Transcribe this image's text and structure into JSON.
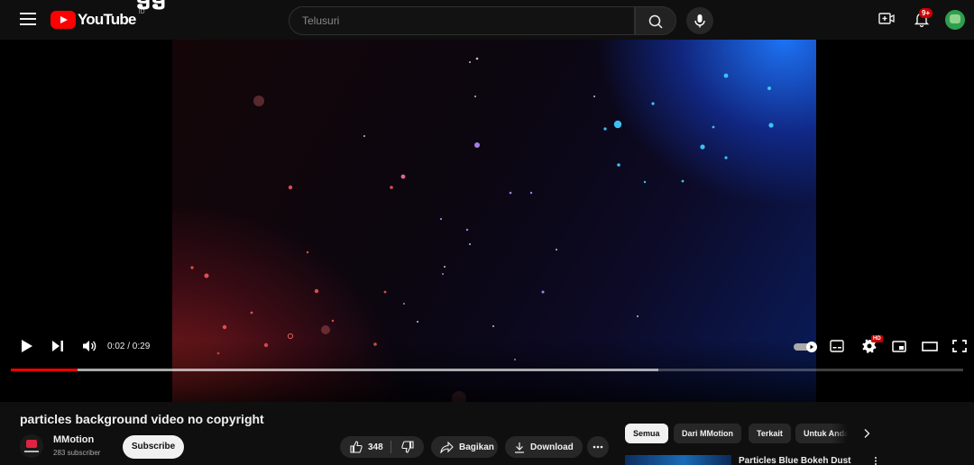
{
  "header": {
    "logo_text": "YouTube",
    "country_code": "ID",
    "top_fragment": "ອອ",
    "search_placeholder": "Telusuri",
    "notification_count": "9+"
  },
  "player": {
    "time_display": "0:02 / 0:29",
    "progress_played": 0.07,
    "progress_buffered": 0.68,
    "quality_badge": "HD"
  },
  "video": {
    "title": "particles background video no copyright",
    "channel_name": "MMotion",
    "channel_subscribers": "283 subscriber",
    "subscribe_label": "Subscribe",
    "like_count": "348",
    "share_label": "Bagikan",
    "download_label": "Download"
  },
  "chips": [
    "Semua",
    "Dari MMotion",
    "Terkait",
    "Untuk Anda"
  ],
  "recommendation": {
    "title": "Particles Blue Bokeh Dust"
  },
  "colors": {
    "brand_red": "#ff0000",
    "background": "#0f0f0f",
    "chip_active": "#f1f1f1"
  }
}
